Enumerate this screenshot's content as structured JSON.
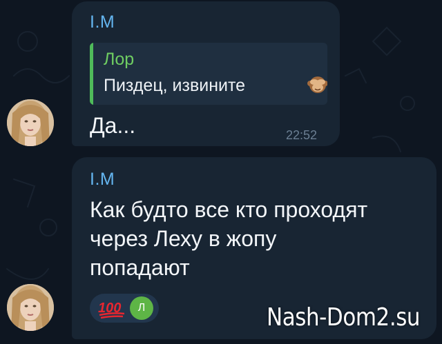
{
  "messages": [
    {
      "sender": "I.M",
      "reply": {
        "name": "Лор",
        "text": "Пиздец, извините",
        "emoji_icon": "see-no-evil-monkey-icon"
      },
      "text": "Да...",
      "time": "22:52"
    },
    {
      "sender": "I.M",
      "lines": [
        "Как будто все кто проходят",
        "через Леху в жопу",
        "попадают"
      ],
      "reactions": {
        "emoji_icon": "hundred-points-icon",
        "emoji_text": "100",
        "reactor_initial": "Л"
      }
    }
  ],
  "watermark": "Nash-Dom2.su",
  "colors": {
    "background": "#0e1621",
    "bubble": "#182533",
    "sender": "#64b5ef",
    "reply_accent": "#4fbb5a",
    "reaction_avatar": "#5eb546"
  }
}
